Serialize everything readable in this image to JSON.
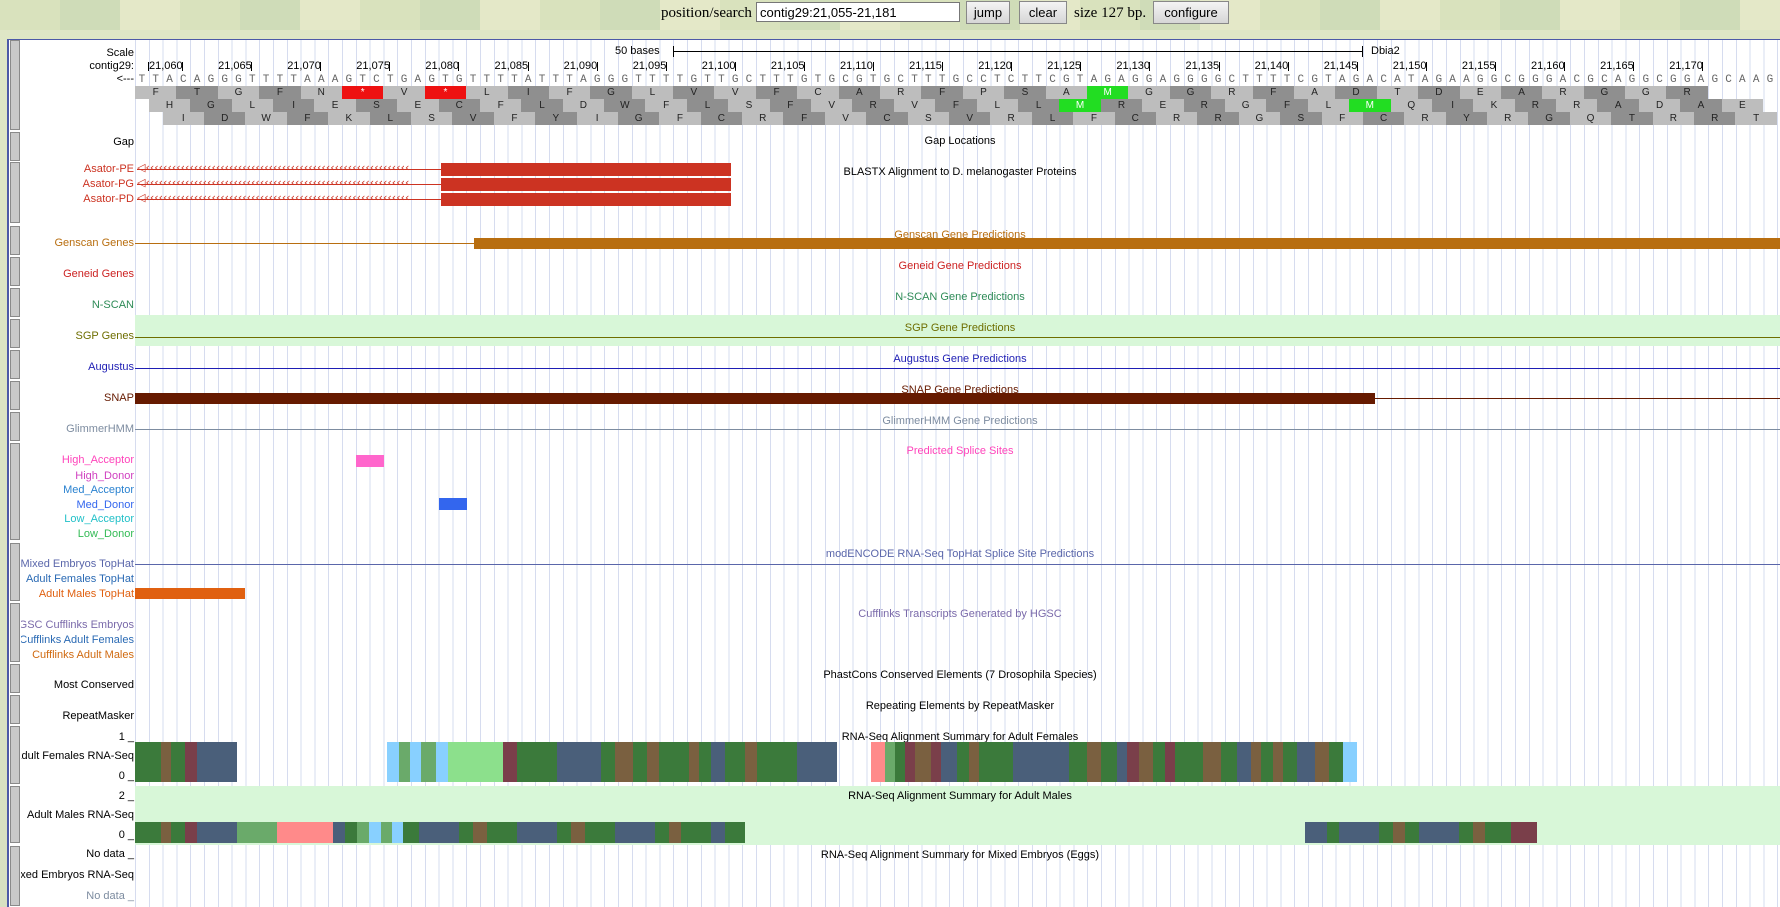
{
  "search": {
    "label": "position/search",
    "value": "contig29:21,055-21,181",
    "jump": "jump",
    "clear": "clear",
    "size": "size 127 bp.",
    "configure": "configure"
  },
  "ruler": {
    "scale_label": "Scale",
    "contig_label": "contig29:",
    "strand_label": "<---",
    "scale_text": "50 bases",
    "assembly": "Dbia2",
    "ticks": [
      "21,060",
      "21,065",
      "21,070",
      "21,075",
      "21,080",
      "21,085",
      "21,090",
      "21,095",
      "21,100",
      "21,105",
      "21,110",
      "21,115",
      "21,120",
      "21,125",
      "21,130",
      "21,135",
      "21,140",
      "21,145",
      "21,150",
      "21,155",
      "21,160",
      "21,165",
      "21,170"
    ]
  },
  "dna": "TTACAGGGTTTTAAAGTCTGAGTGTTTTATTTAGGGTTTTGTTGCTTTGTGCGTGCTTTGCCTCTTCGTAGAGGAGGGGCTTTTCGTAGACATAGAAGGCGGGACGCAGGCGGAGCAAGG",
  "frames": [
    [
      "F",
      "T",
      "G",
      "F",
      "N",
      "*",
      "V",
      "*",
      "L",
      "I",
      "F",
      "G",
      "L",
      "V",
      "V",
      "F",
      "C",
      "A",
      "R",
      "F",
      "P",
      "S",
      "A",
      "M",
      "G",
      "G",
      "R",
      "F",
      "A",
      "D",
      "T",
      "D",
      "E",
      "A",
      "R",
      "G",
      "G",
      "R"
    ],
    [
      "H",
      "G",
      "L",
      "I",
      "E",
      "S",
      "E",
      "C",
      "F",
      "L",
      "D",
      "W",
      "F",
      "L",
      "S",
      "F",
      "V",
      "R",
      "V",
      "F",
      "L",
      "L",
      "M",
      "R",
      "E",
      "R",
      "G",
      "F",
      "L",
      "M",
      "Q",
      "I",
      "K",
      "R",
      "R",
      "A",
      "D",
      "A",
      "E"
    ],
    [
      "I",
      "D",
      "W",
      "F",
      "K",
      "L",
      "S",
      "V",
      "F",
      "Y",
      "I",
      "G",
      "F",
      "C",
      "R",
      "F",
      "V",
      "C",
      "S",
      "V",
      "R",
      "L",
      "F",
      "C",
      "R",
      "R",
      "G",
      "S",
      "F",
      "C",
      "R",
      "Y",
      "R",
      "G",
      "Q",
      "T",
      "R",
      "R",
      "T"
    ]
  ],
  "tracks": {
    "gap": {
      "label": "Gap",
      "title": "Gap Locations"
    },
    "blastx": {
      "title": "BLASTX Alignment to D. melanogaster Proteins",
      "rows": [
        "Asator-PE",
        "Asator-PG",
        "Asator-PD"
      ]
    },
    "genscan": {
      "label": "Genscan Genes",
      "title": "Genscan Gene Predictions"
    },
    "geneid": {
      "label": "Geneid Genes",
      "title": "Geneid Gene Predictions"
    },
    "nscan": {
      "label": "N-SCAN",
      "title": "N-SCAN Gene Predictions"
    },
    "sgp": {
      "label": "SGP Genes",
      "title": "SGP Gene Predictions"
    },
    "augustus": {
      "label": "Augustus",
      "title": "Augustus Gene Predictions"
    },
    "snap": {
      "label": "SNAP",
      "title": "SNAP Gene Predictions"
    },
    "glimmer": {
      "label": "GlimmerHMM",
      "title": "GlimmerHMM Gene Predictions"
    },
    "splice": {
      "title": "Predicted Splice Sites",
      "rows": [
        "High_Acceptor",
        "High_Donor",
        "Med_Acceptor",
        "Med_Donor",
        "Low_Acceptor",
        "Low_Donor"
      ]
    },
    "tophat": {
      "title": "modENCODE RNA-Seq TopHat Splice Site Predictions",
      "rows": [
        "Mixed Embryos TopHat",
        "Adult Females TopHat",
        "Adult Males TopHat"
      ]
    },
    "cufflinks": {
      "title": "Cufflinks Transcripts Generated by HGSC",
      "rows": [
        "HGSC Cufflinks Embryos",
        "Cufflinks Adult Females",
        "Cufflinks Adult Males"
      ]
    },
    "phastcons": {
      "label": "Most Conserved",
      "title": "PhastCons Conserved Elements (7 Drosophila Species)"
    },
    "repeat": {
      "label": "RepeatMasker",
      "title": "Repeating Elements by RepeatMasker"
    },
    "rnaf": {
      "label": "Adult Females RNA-Seq",
      "title": "RNA-Seq Alignment Summary for Adult Females",
      "top": "1 _",
      "bottom": "0 _"
    },
    "rnam": {
      "label": "Adult Males RNA-Seq",
      "title": "RNA-Seq Alignment Summary for Adult Males",
      "top": "2 _",
      "bottom": "0 _"
    },
    "rnae": {
      "label": "Mixed Embryos RNA-Seq",
      "title": "RNA-Seq Alignment Summary for Mixed Embryos (Eggs)",
      "top": "No data _",
      "bottom": "No data _"
    }
  },
  "colors": {
    "blastx": "#cc3322",
    "genscan": "#b86e10",
    "geneid": "#cc2222",
    "nscan": "#2e8b57",
    "sgp": "#6e6e00",
    "augustus": "#1e1eb4",
    "snap": "#661a00",
    "glimmer": "#7d8ca0",
    "highacc": "#ff66cc",
    "meddonor": "#3366ee",
    "tophatm": "#e06010"
  }
}
